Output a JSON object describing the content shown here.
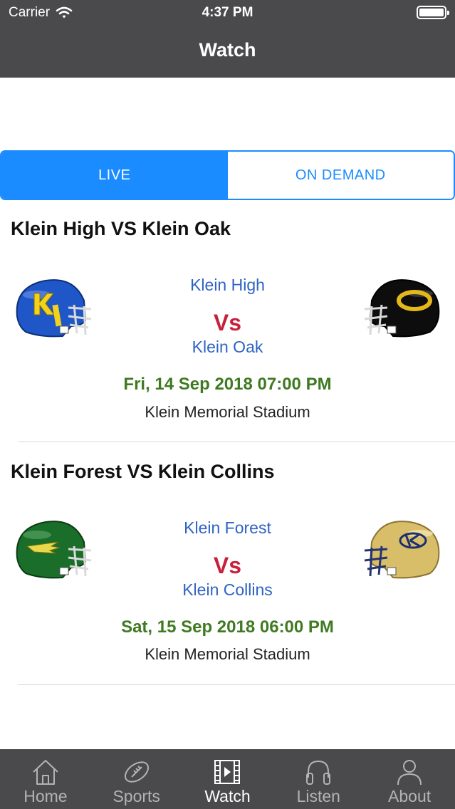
{
  "status_bar": {
    "carrier": "Carrier",
    "time": "4:37 PM"
  },
  "nav": {
    "title": "Watch"
  },
  "segment": {
    "live": "LIVE",
    "on_demand": "ON DEMAND",
    "selected": "LIVE"
  },
  "matches": [
    {
      "title": "Klein High VS Klein Oak",
      "home_team": "Klein High",
      "vs": "Vs",
      "away_team": "Klein Oak",
      "datetime": "Fri, 14 Sep 2018 07:00 PM",
      "venue": "Klein Memorial Stadium",
      "home_helmet": {
        "icon": "helmet-blue-k-bearkats-icon",
        "shell": "#1f57c8",
        "mark": "#f2d21b",
        "mark_text": "K"
      },
      "away_helmet": {
        "icon": "helmet-black-gold-o-icon",
        "shell": "#0d0d0d",
        "mark": "#e5b81a"
      }
    },
    {
      "title": "Klein Forest VS Klein Collins",
      "home_team": "Klein Forest",
      "vs": "Vs",
      "away_team": "Klein Collins",
      "datetime": "Sat, 15 Sep 2018 06:00 PM",
      "venue": "Klein Memorial Stadium",
      "home_helmet": {
        "icon": "helmet-green-wing-icon",
        "shell": "#1a6e2a",
        "mark": "#e8d94a"
      },
      "away_helmet": {
        "icon": "helmet-gold-kc-icon",
        "shell": "#d9be6a",
        "mark": "#1b2e6e"
      }
    }
  ],
  "tab_bar": {
    "items": [
      {
        "label": "Home",
        "icon": "house-icon"
      },
      {
        "label": "Sports",
        "icon": "football-icon"
      },
      {
        "label": "Watch",
        "icon": "film-strip-icon"
      },
      {
        "label": "Listen",
        "icon": "headphones-icon"
      },
      {
        "label": "About",
        "icon": "person-icon"
      }
    ],
    "selected": "Watch"
  },
  "colors": {
    "bar_background": "#4a4a4d",
    "accent_blue": "#1a8cff",
    "team_text": "#2e63c4",
    "vs_red": "#c8203a",
    "date_green": "#3f7a22"
  }
}
